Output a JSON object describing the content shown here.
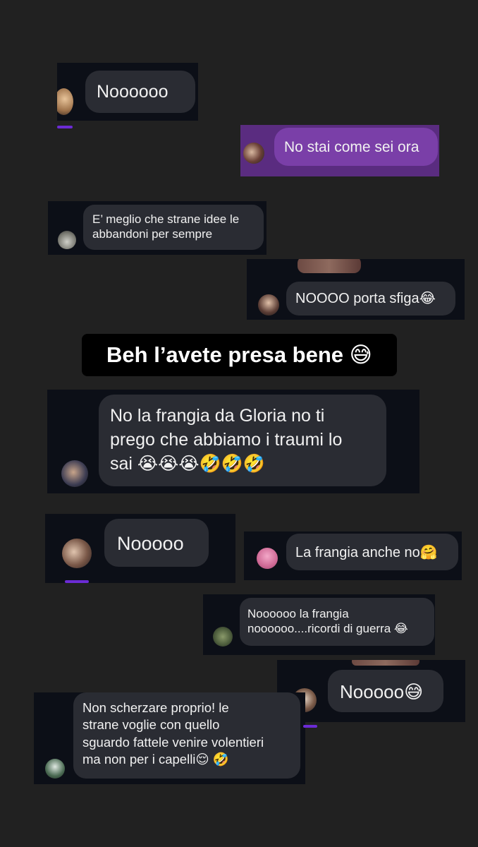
{
  "story_caption": "Beh l’avete presa bene 😅",
  "messages": [
    {
      "text": "Noooooo",
      "color": "#2a2c33"
    },
    {
      "text": "No stai come sei ora",
      "color": "#7a3fa8"
    },
    {
      "text": "E’ meglio che strane idee le\nabbandoni per sempre",
      "color": "#2a2c33"
    },
    {
      "text": "NOOOO porta sfiga😂",
      "color": "#2a2c33"
    },
    {
      "text": "No la frangia da Gloria no ti\nprego che abbiamo i traumi lo\nsai 😭😭😭🤣🤣🤣",
      "color": "#2a2c33"
    },
    {
      "text": "Nooooo",
      "color": "#2a2c33"
    },
    {
      "text": "La frangia anche no🤗",
      "color": "#2a2c33"
    },
    {
      "text": "Noooooo la frangia\nnoooooo....ricordi di guerra 😂",
      "color": "#2a2c33"
    },
    {
      "text": "Nooooo😅",
      "color": "#2a2c33"
    },
    {
      "text": "Non scherzare proprio! le\nstrane voglie con quello\nsguardo fattele venire volentieri\nma non per i capelli😌 🤣",
      "color": "#2a2c33"
    }
  ],
  "avatars": [
    {
      "icon": "avatar-blonde-girl",
      "color": "#c89a6a"
    },
    {
      "icon": "avatar-couple",
      "color": "#6a5046"
    },
    {
      "icon": "avatar-landscape",
      "color": "#9a9a94"
    },
    {
      "icon": "avatar-girl",
      "color": "#7a6458"
    },
    {
      "icon": "avatar-group",
      "color": "#4a4a5a"
    },
    {
      "icon": "avatar-two-girls",
      "color": "#8a6a5e"
    },
    {
      "icon": "avatar-pink-sunset",
      "color": "#e07aa6"
    },
    {
      "icon": "avatar-green-outdoor",
      "color": "#5a6a48"
    },
    {
      "icon": "avatar-dog",
      "color": "#8a7060"
    },
    {
      "icon": "avatar-field",
      "color": "#4a6a52"
    }
  ],
  "colors": {
    "background": "#212121",
    "card": "#0c0f17",
    "accent_purple": "#6b2bd4"
  }
}
